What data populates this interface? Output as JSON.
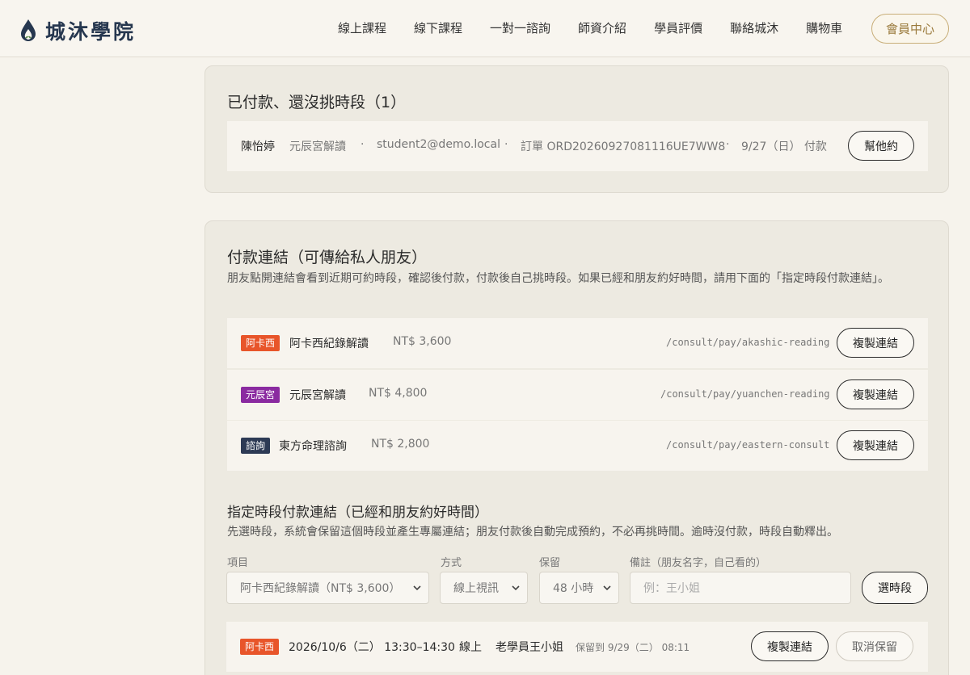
{
  "header": {
    "brand": "城沐學院",
    "nav": [
      "線上課程",
      "線下課程",
      "一對一諮詢",
      "師資介紹",
      "學員評價",
      "聯絡城沐",
      "購物車"
    ],
    "member_button": "會員中心"
  },
  "paid_section": {
    "title": "已付款、還沒挑時段（1）",
    "row": {
      "name": "陳怡婷",
      "service": "元辰宮解讀",
      "sep": "·",
      "email": "student2@demo.local",
      "order": "訂單 ORD20260927081116UE7WW8",
      "paid": "9/27（日） 付款",
      "button": "幫他約"
    }
  },
  "links_section": {
    "title": "付款連結（可傳給私人朋友）",
    "desc": "朋友點開連結會看到近期可約時段，確認後付款，付款後自己挑時段。如果已經和朋友約好時間，請用下面的「指定時段付款連結」。",
    "items": [
      {
        "tag": "阿卡西",
        "tag_color": "#e8552a",
        "name": "阿卡西紀錄解讀",
        "price": "NT$ 3,600",
        "path": "/consult/pay/akashic-reading",
        "button": "複製連結"
      },
      {
        "tag": "元辰宮",
        "tag_color": "#8a2aa0",
        "name": "元辰宮解讀",
        "price": "NT$ 4,800",
        "path": "/consult/pay/yuanchen-reading",
        "button": "複製連結"
      },
      {
        "tag": "諮詢",
        "tag_color": "#2d3a55",
        "name": "東方命理諮詢",
        "price": "NT$ 2,800",
        "path": "/consult/pay/eastern-consult",
        "button": "複製連結"
      }
    ],
    "slot": {
      "title": "指定時段付款連結（已經和朋友約好時間）",
      "desc": "先選時段，系統會保留這個時段並產生專屬連結；朋友付款後自動完成預約，不必再挑時間。逾時沒付款，時段自動釋出。",
      "labels": {
        "item": "項目",
        "mode": "方式",
        "hold": "保留",
        "note": "備註（朋友名字，自己看的）"
      },
      "values": {
        "item": "阿卡西紀錄解讀（NT$ 3,600）",
        "mode": "線上視訊",
        "hold": "48 小時"
      },
      "note_placeholder": "例：王小姐",
      "choose_button": "選時段",
      "reservation": {
        "tag": "阿卡西",
        "tag_color": "#e8552a",
        "datetime": "2026/10/6（二） 13:30–14:30",
        "mode": "線上",
        "who": "老學員王小姐",
        "hold_until": "保留到 9/29（二） 08:11",
        "copy_button": "複製連結",
        "cancel_button": "取消保留"
      }
    }
  }
}
